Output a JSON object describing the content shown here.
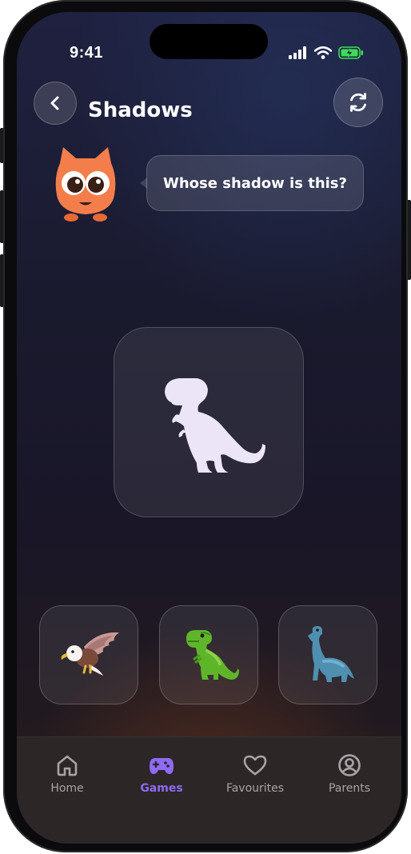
{
  "status_bar": {
    "time": "9:41"
  },
  "header": {
    "title": "Shadows"
  },
  "mascot": {
    "speech": "Whose shadow is this?"
  },
  "choices": [
    {
      "name": "eagle"
    },
    {
      "name": "t-rex"
    },
    {
      "name": "brachiosaurus"
    }
  ],
  "tabs": [
    {
      "label": "Home",
      "icon": "home-icon"
    },
    {
      "label": "Games",
      "icon": "gamepad-icon",
      "active": true
    },
    {
      "label": "Favourites",
      "icon": "heart-icon"
    },
    {
      "label": "Parents",
      "icon": "user-icon"
    }
  ],
  "colors": {
    "accent": "#8f6af2",
    "mascot": "#f47e4b",
    "tab_inactive": "#a9a3a6"
  }
}
